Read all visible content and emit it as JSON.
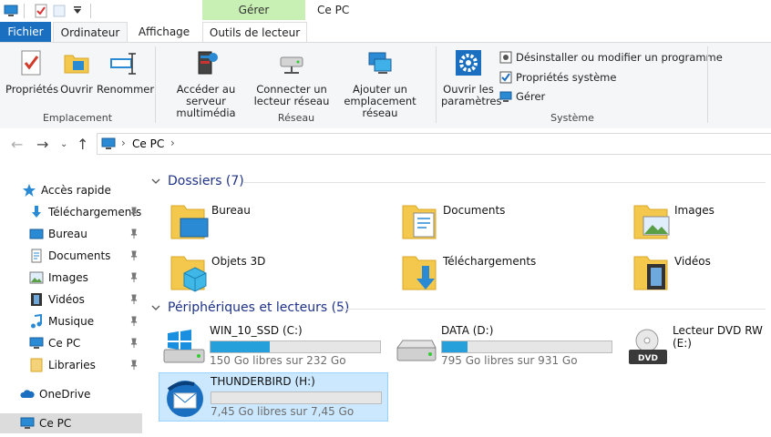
{
  "window": {
    "title": "Ce PC",
    "context_tab_group": "Gérer"
  },
  "tabs": {
    "file": "Fichier",
    "computer": "Ordinateur",
    "view": "Affichage",
    "drive_tools": "Outils de lecteur"
  },
  "ribbon": {
    "location": {
      "label": "Emplacement",
      "properties": "Propriétés",
      "open": "Ouvrir",
      "rename": "Renommer"
    },
    "network": {
      "label": "Réseau",
      "media_server_1": "Accéder au serveur",
      "media_server_2": "multimédia",
      "map_drive_1": "Connecter un",
      "map_drive_2": "lecteur réseau",
      "add_location_1": "Ajouter un",
      "add_location_2": "emplacement réseau"
    },
    "system": {
      "label": "Système",
      "settings_1": "Ouvrir les",
      "settings_2": "paramètres",
      "uninstall": "Désinstaller ou modifier un programme",
      "sys_props": "Propriétés système",
      "manage": "Gérer"
    }
  },
  "address": {
    "crumb": "Ce PC"
  },
  "sidebar": {
    "items": [
      {
        "label": "Accès rapide"
      },
      {
        "label": "Téléchargements"
      },
      {
        "label": "Bureau"
      },
      {
        "label": "Documents"
      },
      {
        "label": "Images"
      },
      {
        "label": "Vidéos"
      },
      {
        "label": "Musique"
      },
      {
        "label": "Ce PC"
      },
      {
        "label": "Libraries"
      },
      {
        "label": "OneDrive"
      },
      {
        "label": "Ce PC"
      }
    ]
  },
  "folders": {
    "heading": "Dossiers (7)",
    "items": [
      "Bureau",
      "Documents",
      "Images",
      "Objets 3D",
      "Téléchargements",
      "Vidéos"
    ]
  },
  "drives": {
    "heading": "Périphériques et lecteurs (5)",
    "items": [
      {
        "name": "WIN_10_SSD (C:)",
        "free": "150 Go libres sur 232 Go",
        "used_fraction": 0.35
      },
      {
        "name": "DATA (D:)",
        "free": "795 Go libres sur 931 Go",
        "used_fraction": 0.15
      },
      {
        "name": "Lecteur DVD RW (E:)"
      },
      {
        "name": "THUNDERBIRD (H:)",
        "free": "7,45 Go libres sur 7,45 Go",
        "used_fraction": 0.0
      }
    ],
    "dvd_label": "DVD"
  },
  "colors": {
    "accent": "#1a6fc1",
    "bar_fill": "#26a0da",
    "heading": "#1e3287",
    "folder": "#f4c84c",
    "context_band": "#c9f0b4"
  }
}
